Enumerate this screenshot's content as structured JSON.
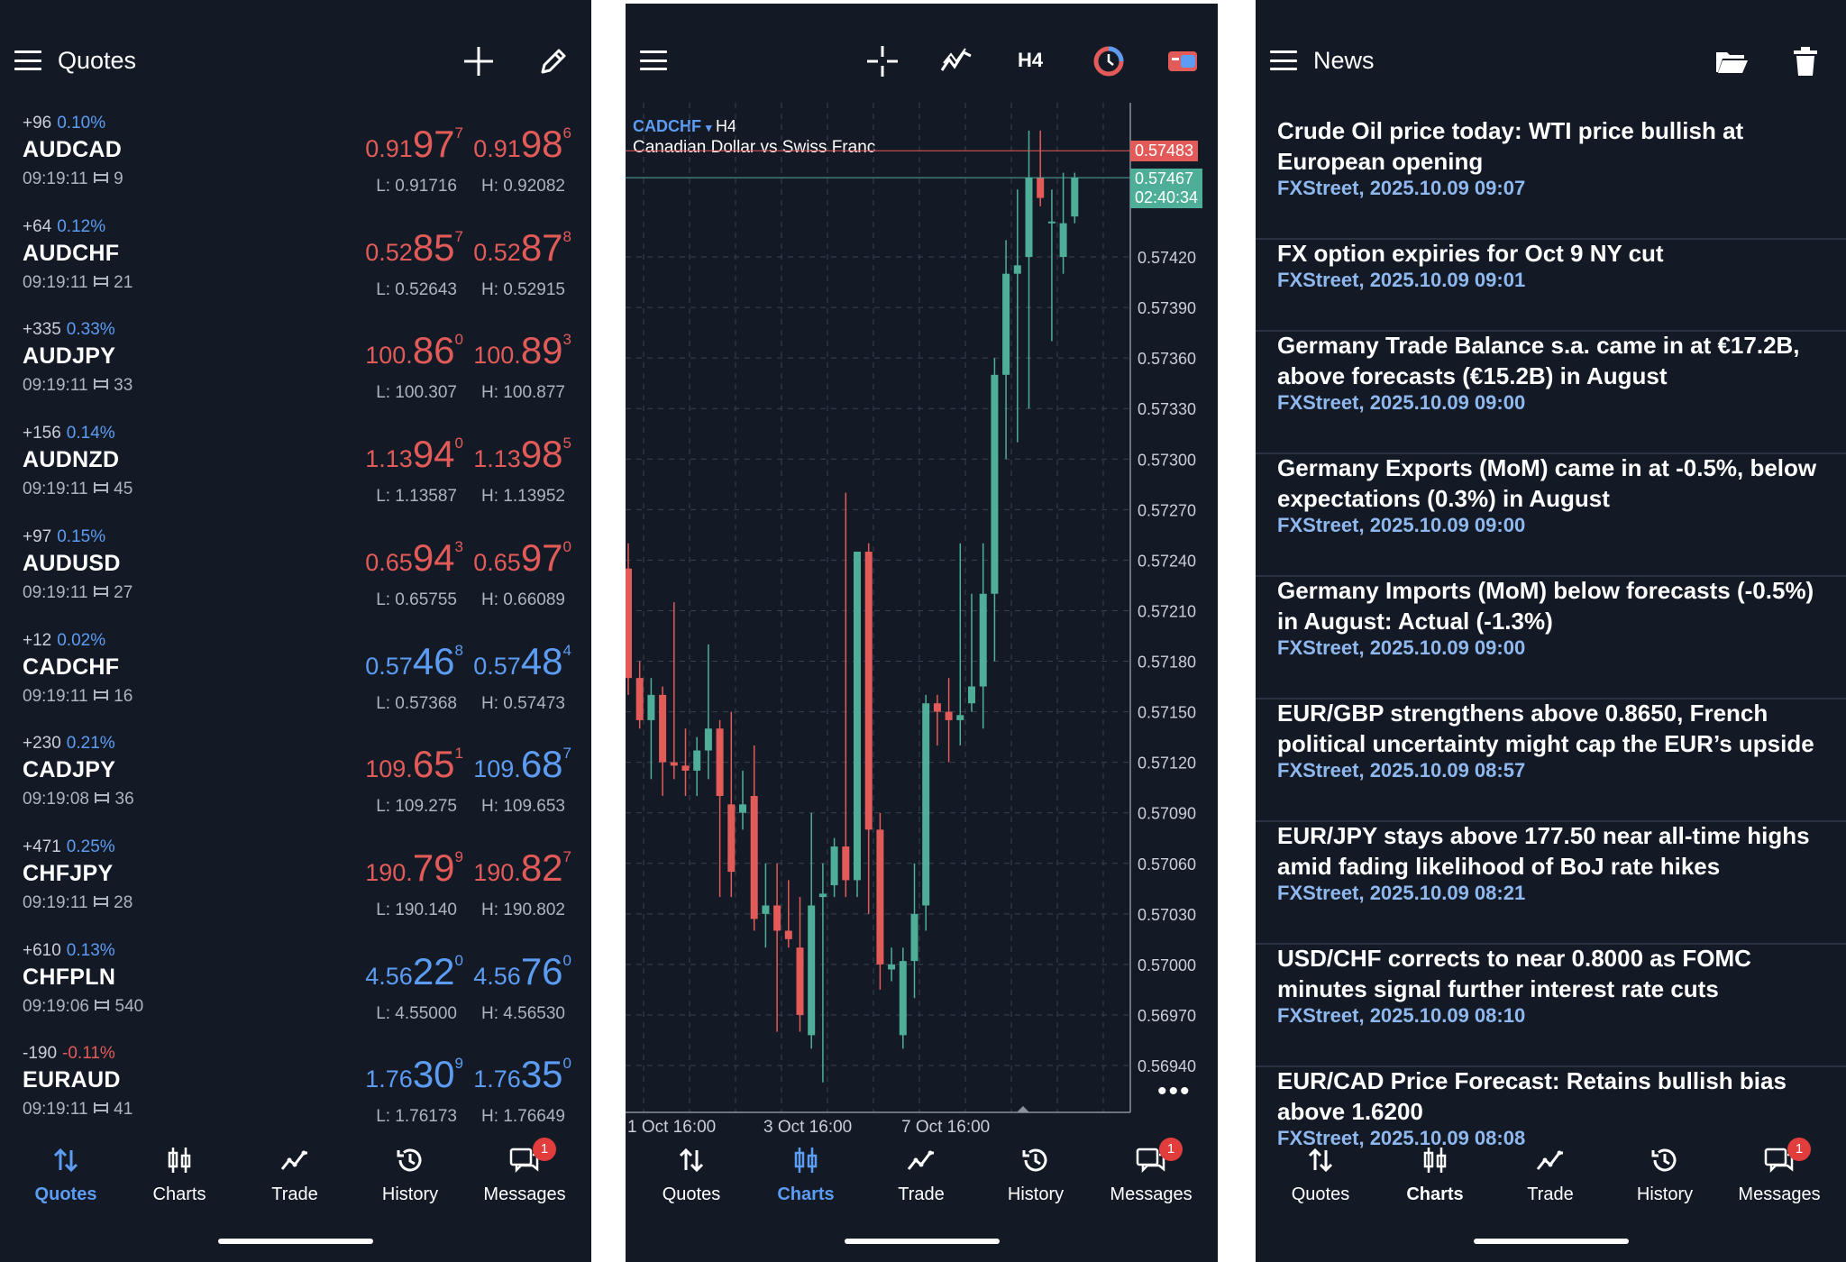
{
  "quotes_panel": {
    "title": "Quotes",
    "rows": [
      {
        "change": "+96",
        "pct": "0.10%",
        "pct_color": "blue",
        "symbol": "AUDCAD",
        "time": "09:19:11",
        "spread": "9",
        "bid": {
          "pre": "0.91",
          "big": "97",
          "sup": "7",
          "color": "red"
        },
        "ask": {
          "pre": "0.91",
          "big": "98",
          "sup": "6",
          "color": "red"
        },
        "low": "L: 0.91716",
        "high": "H: 0.92082"
      },
      {
        "change": "+64",
        "pct": "0.12%",
        "pct_color": "blue",
        "symbol": "AUDCHF",
        "time": "09:19:11",
        "spread": "21",
        "bid": {
          "pre": "0.52",
          "big": "85",
          "sup": "7",
          "color": "red"
        },
        "ask": {
          "pre": "0.52",
          "big": "87",
          "sup": "8",
          "color": "red"
        },
        "low": "L: 0.52643",
        "high": "H: 0.52915"
      },
      {
        "change": "+335",
        "pct": "0.33%",
        "pct_color": "blue",
        "symbol": "AUDJPY",
        "time": "09:19:11",
        "spread": "33",
        "bid": {
          "pre": "100.",
          "big": "86",
          "sup": "0",
          "color": "red"
        },
        "ask": {
          "pre": "100.",
          "big": "89",
          "sup": "3",
          "color": "red"
        },
        "low": "L: 100.307",
        "high": "H: 100.877"
      },
      {
        "change": "+156",
        "pct": "0.14%",
        "pct_color": "blue",
        "symbol": "AUDNZD",
        "time": "09:19:11",
        "spread": "45",
        "bid": {
          "pre": "1.13",
          "big": "94",
          "sup": "0",
          "color": "red"
        },
        "ask": {
          "pre": "1.13",
          "big": "98",
          "sup": "5",
          "color": "red"
        },
        "low": "L: 1.13587",
        "high": "H: 1.13952"
      },
      {
        "change": "+97",
        "pct": "0.15%",
        "pct_color": "blue",
        "symbol": "AUDUSD",
        "time": "09:19:11",
        "spread": "27",
        "bid": {
          "pre": "0.65",
          "big": "94",
          "sup": "3",
          "color": "red"
        },
        "ask": {
          "pre": "0.65",
          "big": "97",
          "sup": "0",
          "color": "red"
        },
        "low": "L: 0.65755",
        "high": "H: 0.66089"
      },
      {
        "change": "+12",
        "pct": "0.02%",
        "pct_color": "blue",
        "symbol": "CADCHF",
        "time": "09:19:11",
        "spread": "16",
        "bid": {
          "pre": "0.57",
          "big": "46",
          "sup": "8",
          "color": "blue"
        },
        "ask": {
          "pre": "0.57",
          "big": "48",
          "sup": "4",
          "color": "blue"
        },
        "low": "L: 0.57368",
        "high": "H: 0.57473"
      },
      {
        "change": "+230",
        "pct": "0.21%",
        "pct_color": "blue",
        "symbol": "CADJPY",
        "time": "09:19:08",
        "spread": "36",
        "bid": {
          "pre": "109.",
          "big": "65",
          "sup": "1",
          "color": "red"
        },
        "ask": {
          "pre": "109.",
          "big": "68",
          "sup": "7",
          "color": "blue"
        },
        "low": "L: 109.275",
        "high": "H: 109.653"
      },
      {
        "change": "+471",
        "pct": "0.25%",
        "pct_color": "blue",
        "symbol": "CHFJPY",
        "time": "09:19:11",
        "spread": "28",
        "bid": {
          "pre": "190.",
          "big": "79",
          "sup": "9",
          "color": "red"
        },
        "ask": {
          "pre": "190.",
          "big": "82",
          "sup": "7",
          "color": "red"
        },
        "low": "L: 190.140",
        "high": "H: 190.802"
      },
      {
        "change": "+610",
        "pct": "0.13%",
        "pct_color": "blue",
        "symbol": "CHFPLN",
        "time": "09:19:06",
        "spread": "540",
        "bid": {
          "pre": "4.56",
          "big": "22",
          "sup": "0",
          "color": "blue"
        },
        "ask": {
          "pre": "4.56",
          "big": "76",
          "sup": "0",
          "color": "blue"
        },
        "low": "L: 4.55000",
        "high": "H: 4.56530"
      },
      {
        "change": "-190",
        "pct": "-0.11%",
        "pct_color": "red",
        "symbol": "EURAUD",
        "time": "09:19:11",
        "spread": "41",
        "bid": {
          "pre": "1.76",
          "big": "30",
          "sup": "9",
          "color": "blue"
        },
        "ask": {
          "pre": "1.76",
          "big": "35",
          "sup": "0",
          "color": "blue"
        },
        "low": "L: 1.76173",
        "high": "H: 1.76649"
      }
    ]
  },
  "chart_panel": {
    "timeframe_button": "H4",
    "symbol": "CADCHF",
    "symbol_dropdown_arrow": "▾",
    "timeframe": "H4",
    "instrument_name": "Canadian Dollar vs Swiss Franc",
    "ask_tag": "0.57483",
    "bid_tag": "0.57467",
    "countdown": "02:40:34",
    "more_label": "•••"
  },
  "news_panel": {
    "title": "News",
    "items": [
      {
        "title": "Crude Oil price today: WTI price bullish at European opening",
        "meta": "FXStreet, 2025.10.09 09:07"
      },
      {
        "title": "FX option expiries for Oct 9 NY cut",
        "meta": "FXStreet, 2025.10.09 09:01"
      },
      {
        "title": "Germany Trade Balance s.a. came in at €17.2B, above forecasts (€15.2B) in August",
        "meta": "FXStreet, 2025.10.09 09:00"
      },
      {
        "title": "Germany Exports (MoM) came in at -0.5%, below expectations (0.3%) in August",
        "meta": "FXStreet, 2025.10.09 09:00"
      },
      {
        "title": "Germany Imports (MoM) below forecasts (-0.5%) in August: Actual (-1.3%)",
        "meta": "FXStreet, 2025.10.09 09:00"
      },
      {
        "title": "EUR/GBP strengthens above 0.8650, French political uncertainty might cap the EUR’s upside",
        "meta": "FXStreet, 2025.10.09 08:57"
      },
      {
        "title": "EUR/JPY stays above 177.50 near all-time highs amid fading likelihood of BoJ rate hikes",
        "meta": "FXStreet, 2025.10.09 08:21"
      },
      {
        "title": "USD/CHF corrects to near 0.8000 as FOMC minutes signal further interest rate cuts",
        "meta": "FXStreet, 2025.10.09 08:10"
      },
      {
        "title": "EUR/CAD Price Forecast: Retains bullish bias above 1.6200",
        "meta": "FXStreet, 2025.10.09 08:08"
      }
    ]
  },
  "nav": {
    "quotes": "Quotes",
    "charts": "Charts",
    "trade": "Trade",
    "history": "History",
    "messages": "Messages",
    "messages_badge": "1"
  },
  "colors": {
    "background": "#131a26",
    "bull": "#4fae98",
    "bear": "#e35b58",
    "accent": "#5c9cf3"
  },
  "chart_data": {
    "type": "candlestick",
    "title": "CADCHF H4",
    "subtitle": "Canadian Dollar vs Swiss Franc",
    "yticks": [
      "0.57420",
      "0.57390",
      "0.57360",
      "0.57330",
      "0.57300",
      "0.57270",
      "0.57240",
      "0.57210",
      "0.57180",
      "0.57150",
      "0.57120",
      "0.57090",
      "0.57060",
      "0.57030",
      "0.57000",
      "0.56970",
      "0.56940"
    ],
    "xticks": [
      "1 Oct 16:00",
      "3 Oct 16:00",
      "7 Oct 16:00"
    ],
    "ylim": [
      0.5692,
      0.575
    ],
    "ask_line": 0.57483,
    "bid_line": 0.57467,
    "candles": [
      {
        "o": 0.57235,
        "h": 0.5725,
        "l": 0.5716,
        "c": 0.5717
      },
      {
        "o": 0.5717,
        "h": 0.5718,
        "l": 0.5714,
        "c": 0.57145
      },
      {
        "o": 0.57145,
        "h": 0.5717,
        "l": 0.5711,
        "c": 0.5716
      },
      {
        "o": 0.5716,
        "h": 0.57165,
        "l": 0.571,
        "c": 0.5712
      },
      {
        "o": 0.5712,
        "h": 0.57215,
        "l": 0.5711,
        "c": 0.57118
      },
      {
        "o": 0.57118,
        "h": 0.5714,
        "l": 0.571,
        "c": 0.57115
      },
      {
        "o": 0.57115,
        "h": 0.57135,
        "l": 0.571,
        "c": 0.57127
      },
      {
        "o": 0.57127,
        "h": 0.5719,
        "l": 0.5711,
        "c": 0.5714
      },
      {
        "o": 0.5714,
        "h": 0.57145,
        "l": 0.5704,
        "c": 0.571
      },
      {
        "o": 0.57095,
        "h": 0.5715,
        "l": 0.5704,
        "c": 0.57055
      },
      {
        "o": 0.5709,
        "h": 0.57115,
        "l": 0.5708,
        "c": 0.57095
      },
      {
        "o": 0.571,
        "h": 0.5713,
        "l": 0.5702,
        "c": 0.57027
      },
      {
        "o": 0.5703,
        "h": 0.5706,
        "l": 0.5701,
        "c": 0.57035
      },
      {
        "o": 0.57035,
        "h": 0.5706,
        "l": 0.5696,
        "c": 0.5702
      },
      {
        "o": 0.5702,
        "h": 0.5705,
        "l": 0.5701,
        "c": 0.57015
      },
      {
        "o": 0.5701,
        "h": 0.5704,
        "l": 0.5696,
        "c": 0.5697
      },
      {
        "o": 0.56958,
        "h": 0.5709,
        "l": 0.5695,
        "c": 0.57035
      },
      {
        "o": 0.5704,
        "h": 0.5706,
        "l": 0.5693,
        "c": 0.57042
      },
      {
        "o": 0.57047,
        "h": 0.57075,
        "l": 0.5704,
        "c": 0.5707
      },
      {
        "o": 0.5707,
        "h": 0.5728,
        "l": 0.5704,
        "c": 0.5705
      },
      {
        "o": 0.5705,
        "h": 0.5724,
        "l": 0.5704,
        "c": 0.57245
      },
      {
        "o": 0.57245,
        "h": 0.5725,
        "l": 0.5703,
        "c": 0.5708
      },
      {
        "o": 0.5708,
        "h": 0.5709,
        "l": 0.56985,
        "c": 0.57
      },
      {
        "o": 0.56997,
        "h": 0.5701,
        "l": 0.5699,
        "c": 0.57
      },
      {
        "o": 0.56958,
        "h": 0.5701,
        "l": 0.5695,
        "c": 0.57002
      },
      {
        "o": 0.57002,
        "h": 0.5706,
        "l": 0.5698,
        "c": 0.5703
      },
      {
        "o": 0.57035,
        "h": 0.5716,
        "l": 0.5702,
        "c": 0.57155
      },
      {
        "o": 0.57155,
        "h": 0.5716,
        "l": 0.5713,
        "c": 0.5715
      },
      {
        "o": 0.5715,
        "h": 0.5717,
        "l": 0.5712,
        "c": 0.57145
      },
      {
        "o": 0.57145,
        "h": 0.5725,
        "l": 0.5713,
        "c": 0.57148
      },
      {
        "o": 0.57155,
        "h": 0.5722,
        "l": 0.5715,
        "c": 0.57165
      },
      {
        "o": 0.57165,
        "h": 0.5725,
        "l": 0.5714,
        "c": 0.5722
      },
      {
        "o": 0.5722,
        "h": 0.5736,
        "l": 0.5718,
        "c": 0.5735
      },
      {
        "o": 0.5735,
        "h": 0.5743,
        "l": 0.573,
        "c": 0.5741
      },
      {
        "o": 0.5741,
        "h": 0.5746,
        "l": 0.5731,
        "c": 0.57415
      },
      {
        "o": 0.5742,
        "h": 0.57495,
        "l": 0.5733,
        "c": 0.57467
      },
      {
        "o": 0.57467,
        "h": 0.57495,
        "l": 0.5745,
        "c": 0.57455
      },
      {
        "o": 0.5744,
        "h": 0.5746,
        "l": 0.5737,
        "c": 0.57441
      },
      {
        "o": 0.5742,
        "h": 0.5747,
        "l": 0.5741,
        "c": 0.5744
      },
      {
        "o": 0.57444,
        "h": 0.5747,
        "l": 0.5744,
        "c": 0.57467
      }
    ]
  }
}
